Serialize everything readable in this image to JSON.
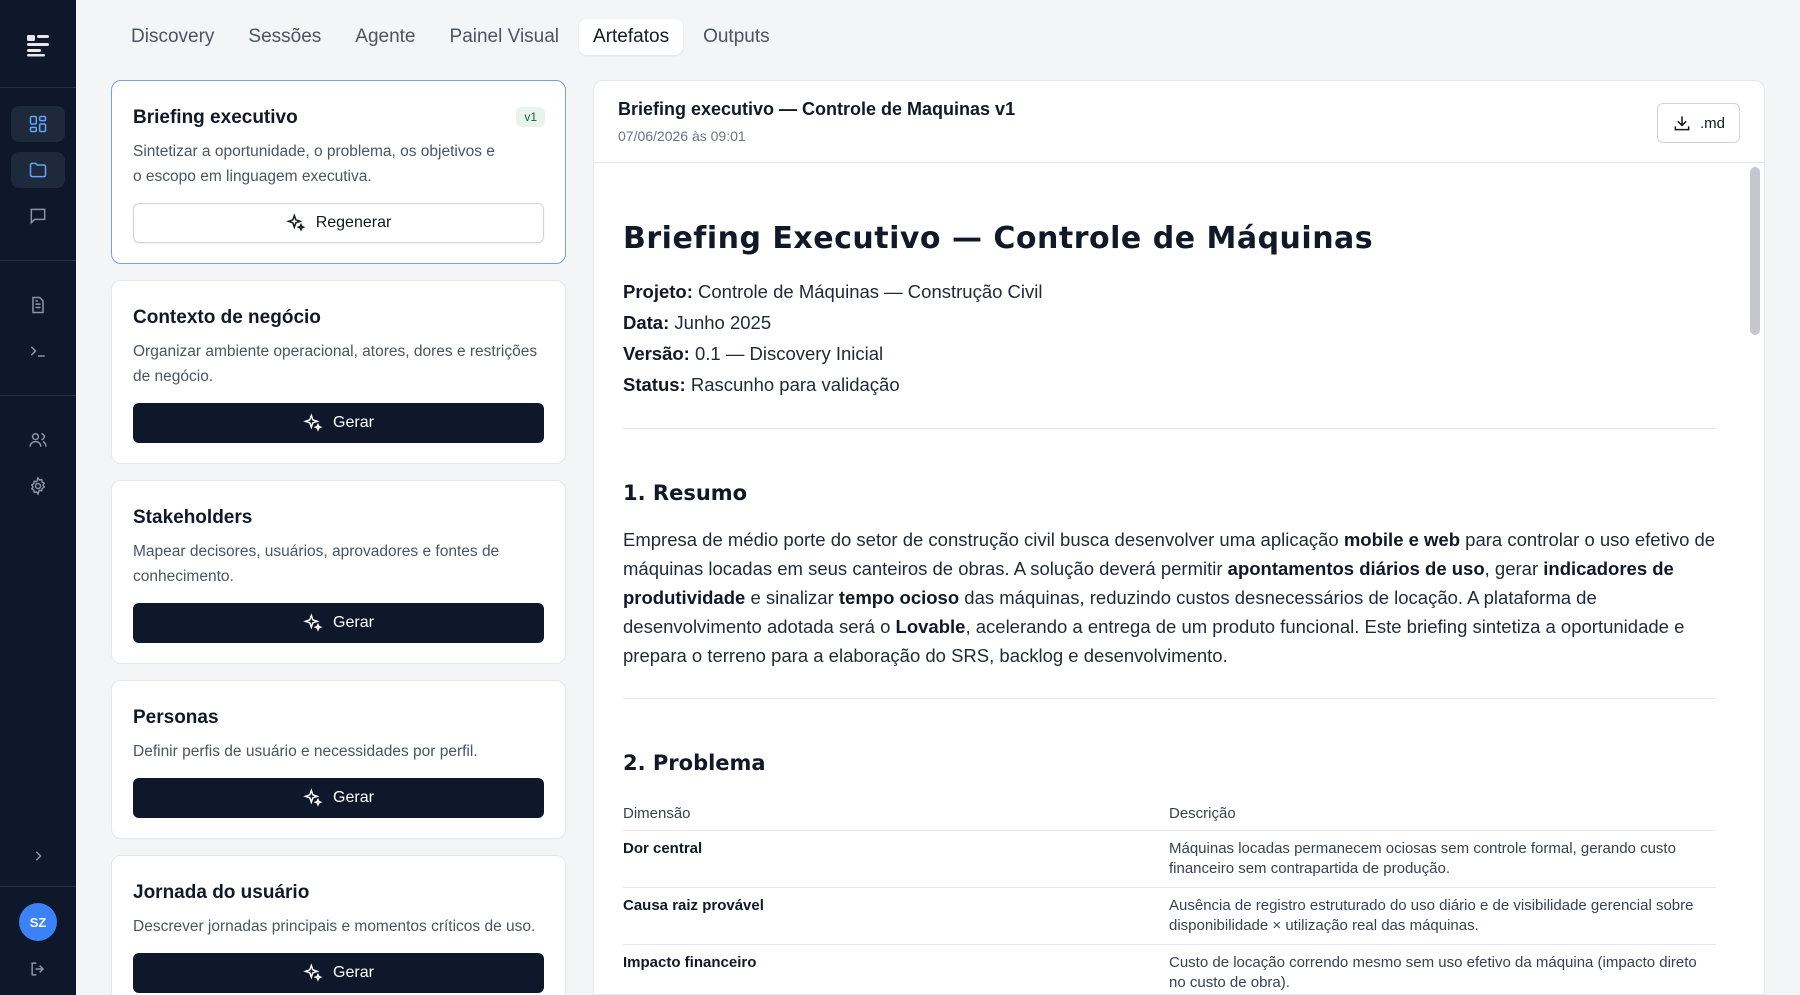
{
  "sidebar": {
    "avatar_initials": "SZ"
  },
  "tabs": [
    {
      "label": "Discovery"
    },
    {
      "label": "Sessões"
    },
    {
      "label": "Agente"
    },
    {
      "label": "Painel Visual"
    },
    {
      "label": "Artefatos"
    },
    {
      "label": "Outputs"
    }
  ],
  "active_tab": "Artefatos",
  "cards": [
    {
      "title": "Briefing executivo",
      "badge": "v1",
      "description": "Sintetizar a oportunidade, o problema, os objetivos e o escopo em linguagem executiva.",
      "button": "Regenerar"
    },
    {
      "title": "Contexto de negócio",
      "description": "Organizar ambiente operacional, atores, dores e restrições de negócio.",
      "button": "Gerar"
    },
    {
      "title": "Stakeholders",
      "description": "Mapear decisores, usuários, aprovadores e fontes de conhecimento.",
      "button": "Gerar"
    },
    {
      "title": "Personas",
      "description": "Definir perfis de usuário e necessidades por perfil.",
      "button": "Gerar"
    },
    {
      "title": "Jornada do usuário",
      "description": "Descrever jornadas principais e momentos críticos de uso.",
      "button": "Gerar"
    }
  ],
  "document": {
    "title": "Briefing executivo — Controle de Maquinas v1",
    "date": "07/06/2026 às 09:01",
    "download_label": ".md",
    "heading": "Briefing Executivo — Controle de Máquinas",
    "meta": [
      {
        "key": "Projeto:",
        "value": "Controle de Máquinas — Construção Civil"
      },
      {
        "key": "Data:",
        "value": "Junho 2025"
      },
      {
        "key": "Versão:",
        "value": "0.1 — Discovery Inicial"
      },
      {
        "key": "Status:",
        "value": "Rascunho para validação"
      }
    ],
    "section1_title": "1. Resumo",
    "section1_parts": [
      "Empresa de médio porte do setor de construção civil busca desenvolver uma aplicação ",
      "mobile e web",
      " para controlar o uso efetivo de máquinas locadas em seus canteiros de obras. A solução deverá permitir ",
      "apontamentos diários de uso",
      ", gerar ",
      "indicadores de produtividade",
      " e sinalizar ",
      "tempo ocioso",
      " das máquinas, reduzindo custos desnecessários de locação. A plataforma de desenvolvimento adotada será o ",
      "Lovable",
      ", acelerando a entrega de um produto funcional. Este briefing sintetiza a oportunidade e prepara o terreno para a elaboração do SRS, backlog e desenvolvimento."
    ],
    "section2_title": "2. Problema",
    "table_headers": [
      "Dimensão",
      "Descrição"
    ],
    "table_rows": [
      [
        "Dor central",
        "Máquinas locadas permanecem ociosas sem controle formal, gerando custo financeiro sem contrapartida de produção."
      ],
      [
        "Causa raiz provável",
        "Ausência de registro estruturado do uso diário e de visibilidade gerencial sobre disponibilidade × utilização real das máquinas."
      ],
      [
        "Impacto financeiro",
        "Custo de locação correndo mesmo sem uso efetivo da máquina (impacto direto no custo de obra)."
      ]
    ]
  }
}
